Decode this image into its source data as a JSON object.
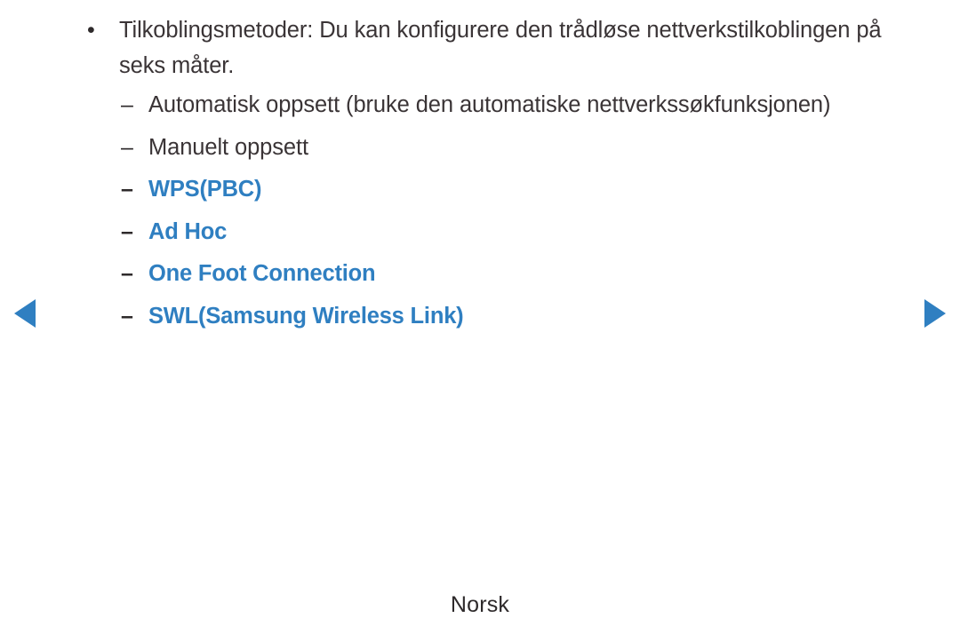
{
  "page": {
    "background_color": "#ffffff",
    "text_color": "#3a3436",
    "accent_color": "#2f7fc1"
  },
  "bullet": {
    "marker": "•",
    "text": "Tilkoblingsmetoder: Du kan konfigurere den trådløse nettverkstilkoblingen på seks måter."
  },
  "sub_items": [
    {
      "marker": "–",
      "label": "Automatisk oppsett (bruke den automatiske nettverkssøkfunksjonen)",
      "highlighted": false
    },
    {
      "marker": "–",
      "label": "Manuelt oppsett",
      "highlighted": false
    },
    {
      "marker": "–",
      "label": "WPS(PBC)",
      "highlighted": true
    },
    {
      "marker": "–",
      "label": "Ad Hoc",
      "highlighted": true
    },
    {
      "marker": "–",
      "label": "One Foot Connection",
      "highlighted": true
    },
    {
      "marker": "–",
      "label": "SWL(Samsung Wireless Link)",
      "highlighted": true
    }
  ],
  "navigation": {
    "previous_icon": "triangle-left-icon",
    "next_icon": "triangle-right-icon"
  },
  "footer": {
    "language": "Norsk"
  }
}
